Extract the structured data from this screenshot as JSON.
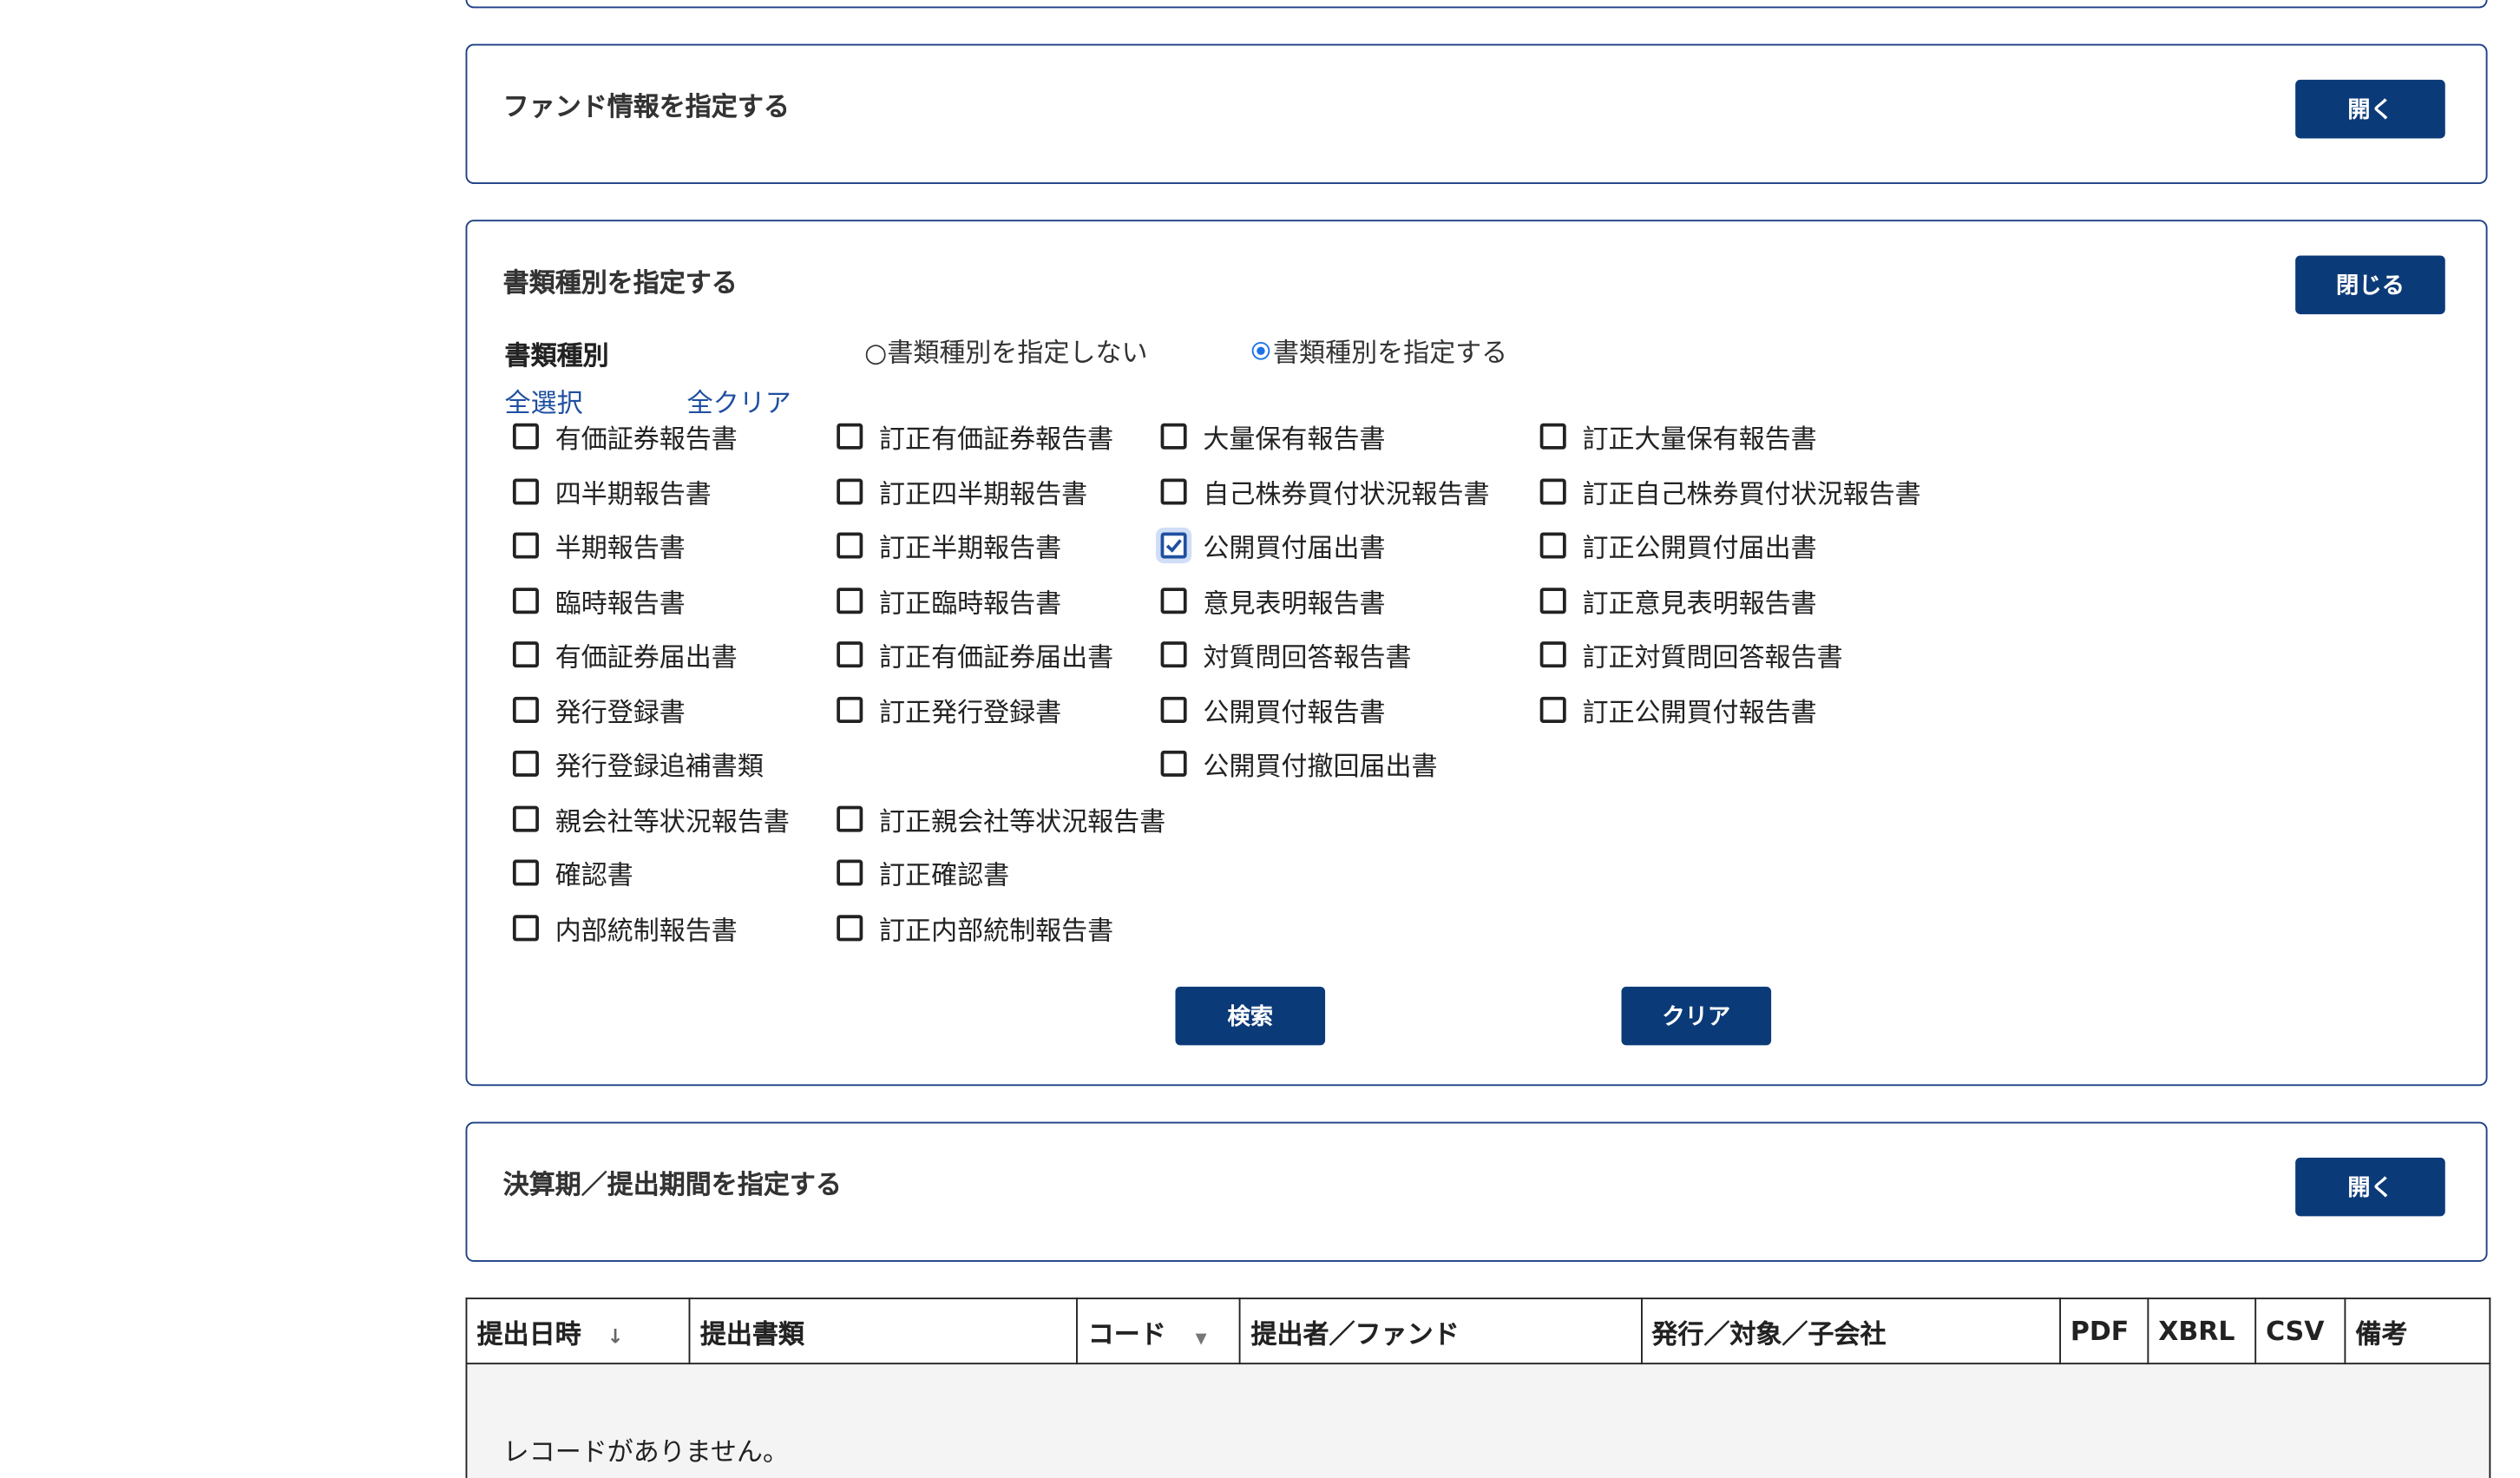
{
  "fund_panel": {
    "title": "ファンド情報を指定する",
    "toggle_label": "開く"
  },
  "doc_panel": {
    "title": "書類種別を指定する",
    "toggle_label": "閉じる",
    "field_label": "書類種別",
    "radio_none": "○書類種別を指定しない",
    "radio_specify": "書類種別を指定する",
    "select_all": "全選択",
    "clear_all": "全クリア",
    "columns": [
      [
        {
          "label": "有価証券報告書",
          "checked": false
        },
        {
          "label": "四半期報告書",
          "checked": false
        },
        {
          "label": "半期報告書",
          "checked": false
        },
        {
          "label": "臨時報告書",
          "checked": false
        },
        {
          "label": "有価証券届出書",
          "checked": false
        },
        {
          "label": "発行登録書",
          "checked": false
        },
        {
          "label": "発行登録追補書類",
          "checked": false
        },
        {
          "label": "親会社等状況報告書",
          "checked": false
        },
        {
          "label": "確認書",
          "checked": false
        },
        {
          "label": "内部統制報告書",
          "checked": false
        }
      ],
      [
        {
          "label": "訂正有価証券報告書",
          "checked": false
        },
        {
          "label": "訂正四半期報告書",
          "checked": false
        },
        {
          "label": "訂正半期報告書",
          "checked": false
        },
        {
          "label": "訂正臨時報告書",
          "checked": false
        },
        {
          "label": "訂正有価証券届出書",
          "checked": false
        },
        {
          "label": "訂正発行登録書",
          "checked": false
        },
        null,
        {
          "label": "訂正親会社等状況報告書",
          "checked": false
        },
        {
          "label": "訂正確認書",
          "checked": false
        },
        {
          "label": "訂正内部統制報告書",
          "checked": false
        }
      ],
      [
        {
          "label": "大量保有報告書",
          "checked": false
        },
        {
          "label": "自己株券買付状況報告書",
          "checked": false
        },
        {
          "label": "公開買付届出書",
          "checked": true
        },
        {
          "label": "意見表明報告書",
          "checked": false
        },
        {
          "label": "対質問回答報告書",
          "checked": false
        },
        {
          "label": "公開買付報告書",
          "checked": false
        },
        {
          "label": "公開買付撤回届出書",
          "checked": false
        }
      ],
      [
        {
          "label": "訂正大量保有報告書",
          "checked": false
        },
        {
          "label": "訂正自己株券買付状況報告書",
          "checked": false
        },
        {
          "label": "訂正公開買付届出書",
          "checked": false
        },
        {
          "label": "訂正意見表明報告書",
          "checked": false
        },
        {
          "label": "訂正対質問回答報告書",
          "checked": false
        },
        {
          "label": "訂正公開買付報告書",
          "checked": false
        }
      ]
    ],
    "search_label": "検索",
    "clear_label": "クリア"
  },
  "period_panel": {
    "title": "決算期／提出期間を指定する",
    "toggle_label": "開く"
  },
  "results_table": {
    "headers": [
      "提出日時",
      "提出書類",
      "コード",
      "提出者／ファンド",
      "発行／対象／子会社",
      "PDF",
      "XBRL",
      "CSV",
      "備考"
    ],
    "sort_indicator": "↓",
    "filter_indicator": "▼",
    "empty_message": "レコードがありません。"
  },
  "colors": {
    "primary": "#0b3a78",
    "border": "#1c3f86",
    "link": "#1f4fa0"
  }
}
